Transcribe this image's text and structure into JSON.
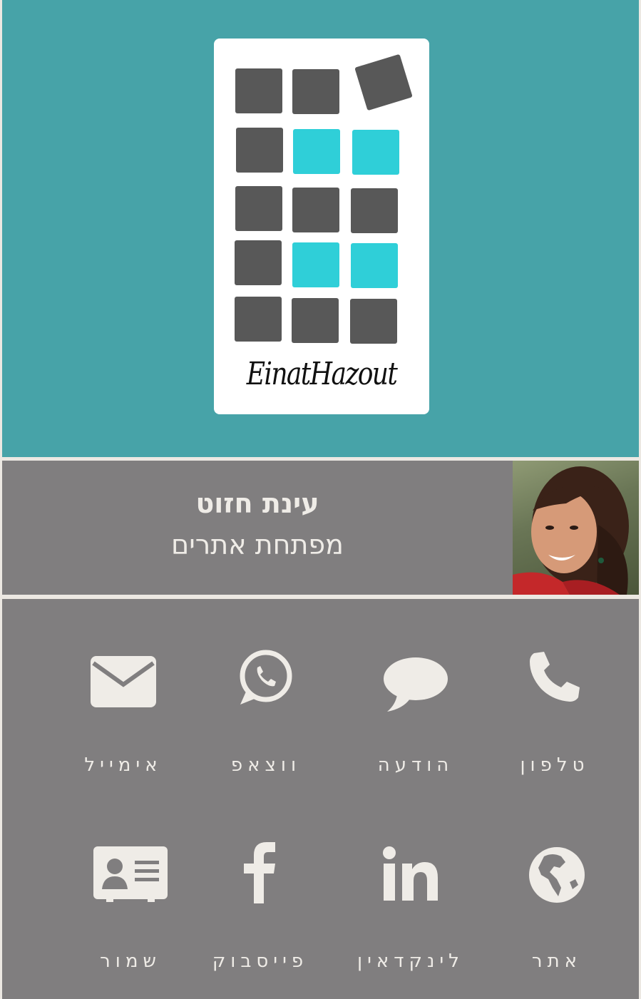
{
  "logo": {
    "signature": "EinatHazout"
  },
  "profile": {
    "name": "עינת חזוט",
    "title": "מפתחת אתרים"
  },
  "actions": {
    "row1": [
      {
        "label": "אימייל",
        "icon": "envelope-icon"
      },
      {
        "label": "ווצאפ",
        "icon": "whatsapp-icon"
      },
      {
        "label": "הודעה",
        "icon": "speech-bubble-icon"
      },
      {
        "label": "טלפון",
        "icon": "phone-icon"
      }
    ],
    "row2": [
      {
        "label": "שמור",
        "icon": "contact-card-icon"
      },
      {
        "label": "פייסבוק",
        "icon": "facebook-icon"
      },
      {
        "label": "לינקדאין",
        "icon": "linkedin-icon"
      },
      {
        "label": "אתר",
        "icon": "globe-icon"
      }
    ]
  },
  "colors": {
    "header_bg": "#47a3a8",
    "panel_bg": "#807e7f",
    "icon_color": "#efece7",
    "tile_dark": "#585858",
    "tile_cyan": "#2fcfd8"
  }
}
